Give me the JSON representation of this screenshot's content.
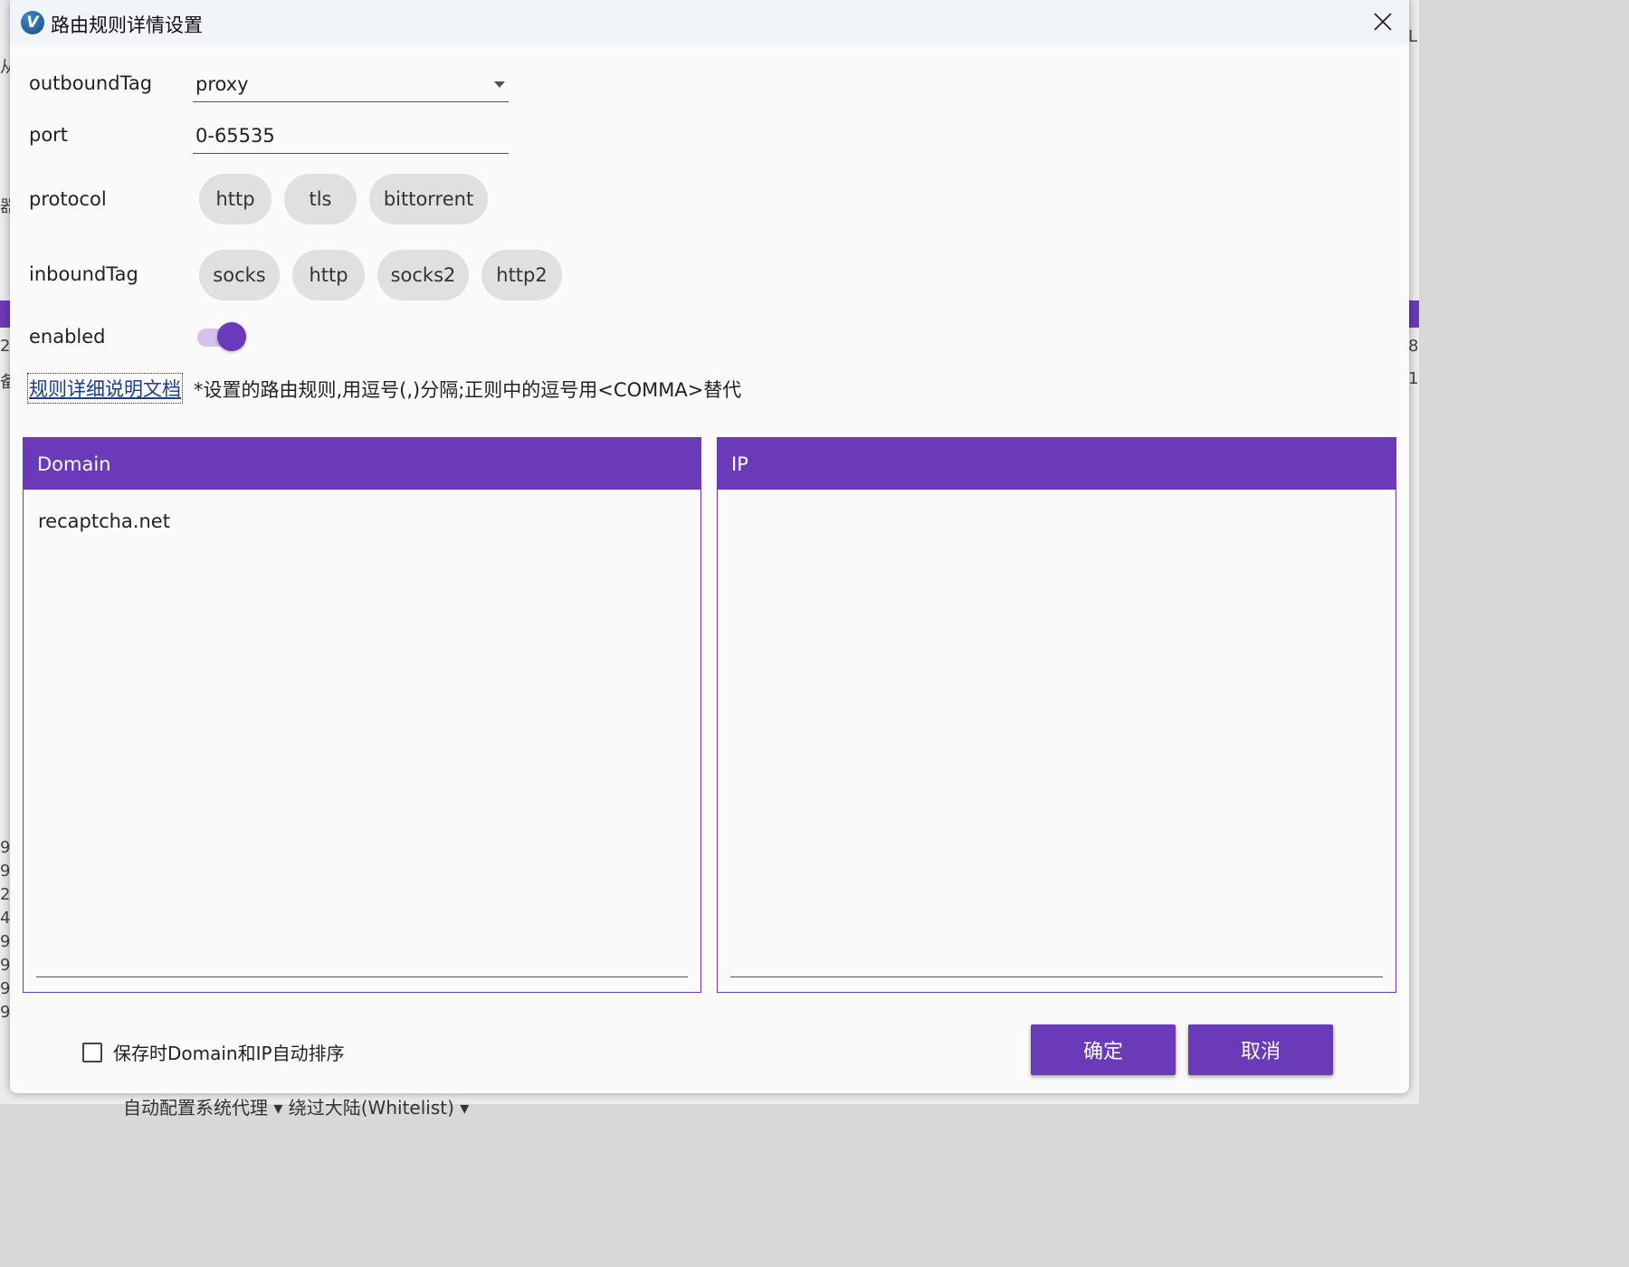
{
  "window": {
    "title": "路由规则详情设置",
    "icon_letter": "V"
  },
  "form": {
    "outbound_label": "outboundTag",
    "outbound_value": "proxy",
    "port_label": "port",
    "port_value": "0-65535",
    "protocol_label": "protocol",
    "protocol_chips": [
      "http",
      "tls",
      "bittorrent"
    ],
    "inbound_label": "inboundTag",
    "inbound_chips": [
      "socks",
      "http",
      "socks2",
      "http2"
    ],
    "enabled_label": "enabled",
    "enabled": true
  },
  "doc": {
    "link_text": "规则详细说明文档",
    "hint": "*设置的路由规则,用逗号(,)分隔;正则中的逗号用<COMMA>替代"
  },
  "panels": {
    "domain_header": "Domain",
    "domain_text": "recaptcha.net",
    "ip_header": "IP",
    "ip_text": ""
  },
  "footer": {
    "sort_checkbox_label": "保存时Domain和IP自动排序",
    "sort_checked": false,
    "ok_label": "确定",
    "cancel_label": "取消"
  },
  "background": {
    "bottom_text": "自动配置系统代理     ▾     绕过大陆(Whitelist)     ▾"
  },
  "colors": {
    "accent": "#6b3ab8",
    "toggle_track": "#d4c2ec",
    "chip": "#e0e0e0"
  }
}
